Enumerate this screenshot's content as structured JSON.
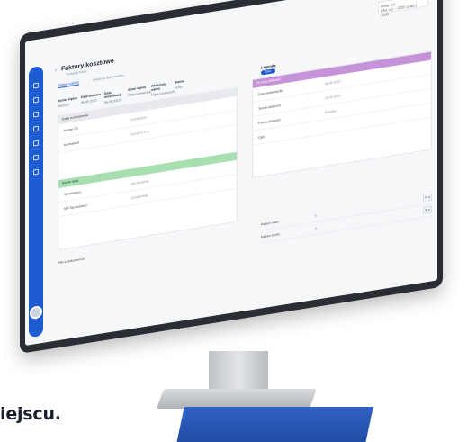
{
  "page": {
    "title": "Faktury kosztowe",
    "subtitle": "Podgląd faktur",
    "back_icon": "‹",
    "top_icons": "% ☰ ☐ ∠ ⌃",
    "user_label": "Witaj, szr",
    "user_value": "Filia s.p. - 2023 (Zakt.) 1000"
  },
  "tabs": [
    {
      "label": "Widok ogólny",
      "active": true
    },
    {
      "label": "Historia dokumentu",
      "active": false
    }
  ],
  "meta": [
    {
      "label": "Numer wpisu",
      "value": "05/2023"
    },
    {
      "label": "Data dodania",
      "value": "06.05.2023"
    },
    {
      "label": "Data modyfikacji",
      "value": "06.05.2023"
    },
    {
      "label": "Autor wpisu",
      "value": "Filipa Kowalczyk"
    },
    {
      "label": "Właściciel wpisu",
      "value": "Filipa Kowalczyk"
    },
    {
      "label": "Status",
      "value": "Nowy"
    }
  ],
  "legend": {
    "label": "Legenda",
    "chip": "Zatw."
  },
  "left_card": {
    "header": "Dane podstawowe",
    "rows": [
      {
        "k": "Numer FV",
        "v": "FV/05/2023"
      },
      {
        "k": "Kontrahent",
        "v": "Comarch S.A."
      }
    ],
    "green_header": "Kwota netto",
    "rows2": [
      {
        "k": "Sprzedawca",
        "v": "Jan Kowalski"
      },
      {
        "k": "NIP Sprzedawcy",
        "v": "1234567890"
      }
    ]
  },
  "right_card": {
    "header": "Terminy płatności",
    "rows": [
      {
        "k": "Data wystawienia",
        "v": "06.05.2023"
      },
      {
        "k": "Termin płatności",
        "v": "20.05.2023"
      },
      {
        "k": "Forma płatności",
        "v": "Przelew"
      },
      {
        "k": "Opis",
        "v": ""
      }
    ]
  },
  "attachments": "Pliki w dokumencie",
  "sums": [
    {
      "k": "Razem netto",
      "v": "0",
      "btn": "PLN"
    },
    {
      "k": "Razem brutto",
      "v": "0",
      "btn": "PLN"
    }
  ],
  "caption": "iejscu."
}
